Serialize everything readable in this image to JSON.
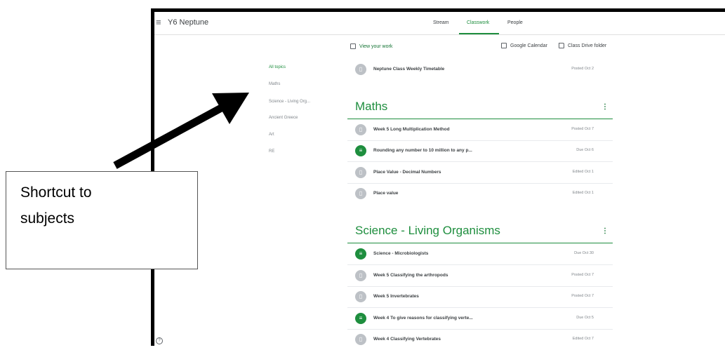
{
  "app": {
    "class_name": "Y6 Neptune",
    "tabs": [
      {
        "label": "Stream"
      },
      {
        "label": "Classwork",
        "active": true
      },
      {
        "label": "People"
      }
    ]
  },
  "toolbar": {
    "view_work": "View your work",
    "google_calendar": "Google Calendar",
    "drive_folder": "Class Drive folder"
  },
  "topics": [
    "All topics",
    "Maths",
    "Science - Living Org...",
    "Ancient Greece",
    "Art",
    "RE"
  ],
  "pinned": {
    "title": "Neptune Class Weekly Timetable",
    "status": "Posted Oct 2",
    "type": "material"
  },
  "sections": [
    {
      "title": "Maths",
      "items": [
        {
          "title": "Week 5 Long Multiplication Method",
          "status": "Posted Oct 7",
          "type": "material"
        },
        {
          "title": "Rounding any number to 10 million to any p...",
          "status": "Due Oct 6",
          "type": "assignment"
        },
        {
          "title": "Place Value - Decimal Numbers",
          "status": "Edited Oct 1",
          "type": "material"
        },
        {
          "title": "Place value",
          "status": "Edited Oct 1",
          "type": "material"
        }
      ]
    },
    {
      "title": "Science - Living Organisms",
      "items": [
        {
          "title": "Science - Microbiologists",
          "status": "Due Oct 30",
          "type": "assignment"
        },
        {
          "title": "Week 5 Classifying the arthropods",
          "status": "Posted Oct 7",
          "type": "material"
        },
        {
          "title": "Week 5 Invertebrates",
          "status": "Posted Oct 7",
          "type": "material"
        },
        {
          "title": "Week 4 To give reasons for classifying verte...",
          "status": "Due Oct 5",
          "type": "assignment"
        },
        {
          "title": "Week 4 Classifying Vertebrates",
          "status": "Edited Oct 7",
          "type": "material"
        }
      ]
    }
  ],
  "callout": {
    "line1": "Shortcut to",
    "line2": "subjects"
  },
  "colors": {
    "accent": "#1e8e3e",
    "material_icon": "#bdc1c6",
    "frame": "#000000"
  }
}
